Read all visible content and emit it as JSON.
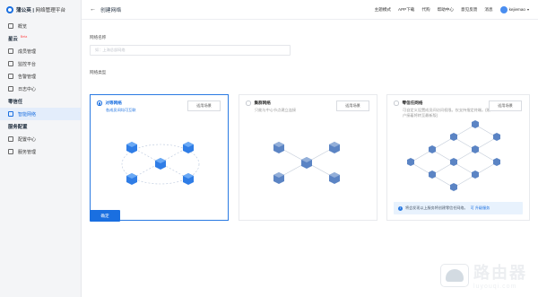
{
  "brand": {
    "name": "蒲公英",
    "subtitle": "网络管理平台"
  },
  "sidebar": {
    "overview": "概览",
    "group_star": {
      "title": "星云",
      "badge": "Beta"
    },
    "star_items": [
      "成员管理",
      "监控平台",
      "告警管理",
      "日志中心"
    ],
    "group_zero": {
      "title": "零信任"
    },
    "zero_items": [
      "智能网络"
    ],
    "group_service": {
      "title": "服务配置"
    },
    "service_items": [
      "配置中心",
      "服务管理"
    ]
  },
  "topbar": {
    "back": "←",
    "title": "创建网络",
    "links": [
      "主题模式",
      "APP下载",
      "代购",
      "帮助中心",
      "意见反馈",
      "消息"
    ],
    "username": "kejiemao",
    "caret": "▾"
  },
  "form": {
    "name_label": "网络名称",
    "name_placeholder": "如：上海总部网络",
    "type_label": "网络类型",
    "confirm": "确定"
  },
  "cards": [
    {
      "title": "对等网络",
      "desc": "各成员间均可互联",
      "button": "适用场景",
      "selected": true
    },
    {
      "title": "集群网络",
      "desc": "只能与中心节点建立连接",
      "button": "适用场景",
      "selected": false
    },
    {
      "title": "零信任网络",
      "desc": "可自定义设置成员间访问权限。仅支持指定终端。(账户接着将转至最新版)",
      "button": "适用场景",
      "selected": false
    }
  ],
  "notice": {
    "icon": "i",
    "text": "将会发现以上服务将创建零信任网络。",
    "link": "可 升级服务"
  },
  "watermark": {
    "main": "路由器",
    "sub": "luyouqi.com"
  },
  "colors": {
    "accent": "#1a6fe0",
    "node": "#2f7de6",
    "node_muted": "#5b84c4"
  }
}
